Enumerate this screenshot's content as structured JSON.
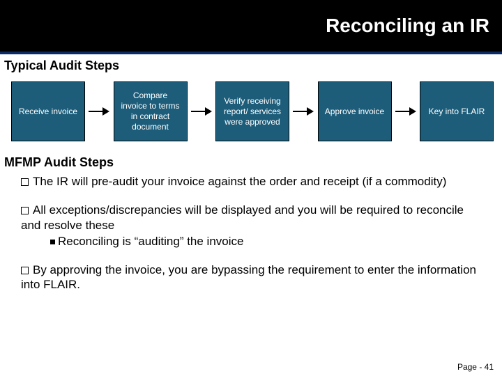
{
  "title": "Reconciling an IR",
  "sections": {
    "typical": "Typical Audit Steps",
    "mfmp": "MFMP Audit Steps"
  },
  "flow": [
    "Receive invoice",
    "Compare invoice to terms in contract document",
    "Verify receiving report/ services were approved",
    "Approve invoice",
    "Key into FLAIR"
  ],
  "bullets": {
    "b1": "The IR will pre-audit your invoice against the order and receipt (if a commodity)",
    "b2": "All exceptions/discrepancies will be displayed and you will be required to reconcile and resolve these",
    "b2sub": "Reconciling is “auditing” the invoice",
    "b3": "By approving the invoice, you are bypassing the requirement to enter the information into FLAIR."
  },
  "footer": "Page - 41"
}
